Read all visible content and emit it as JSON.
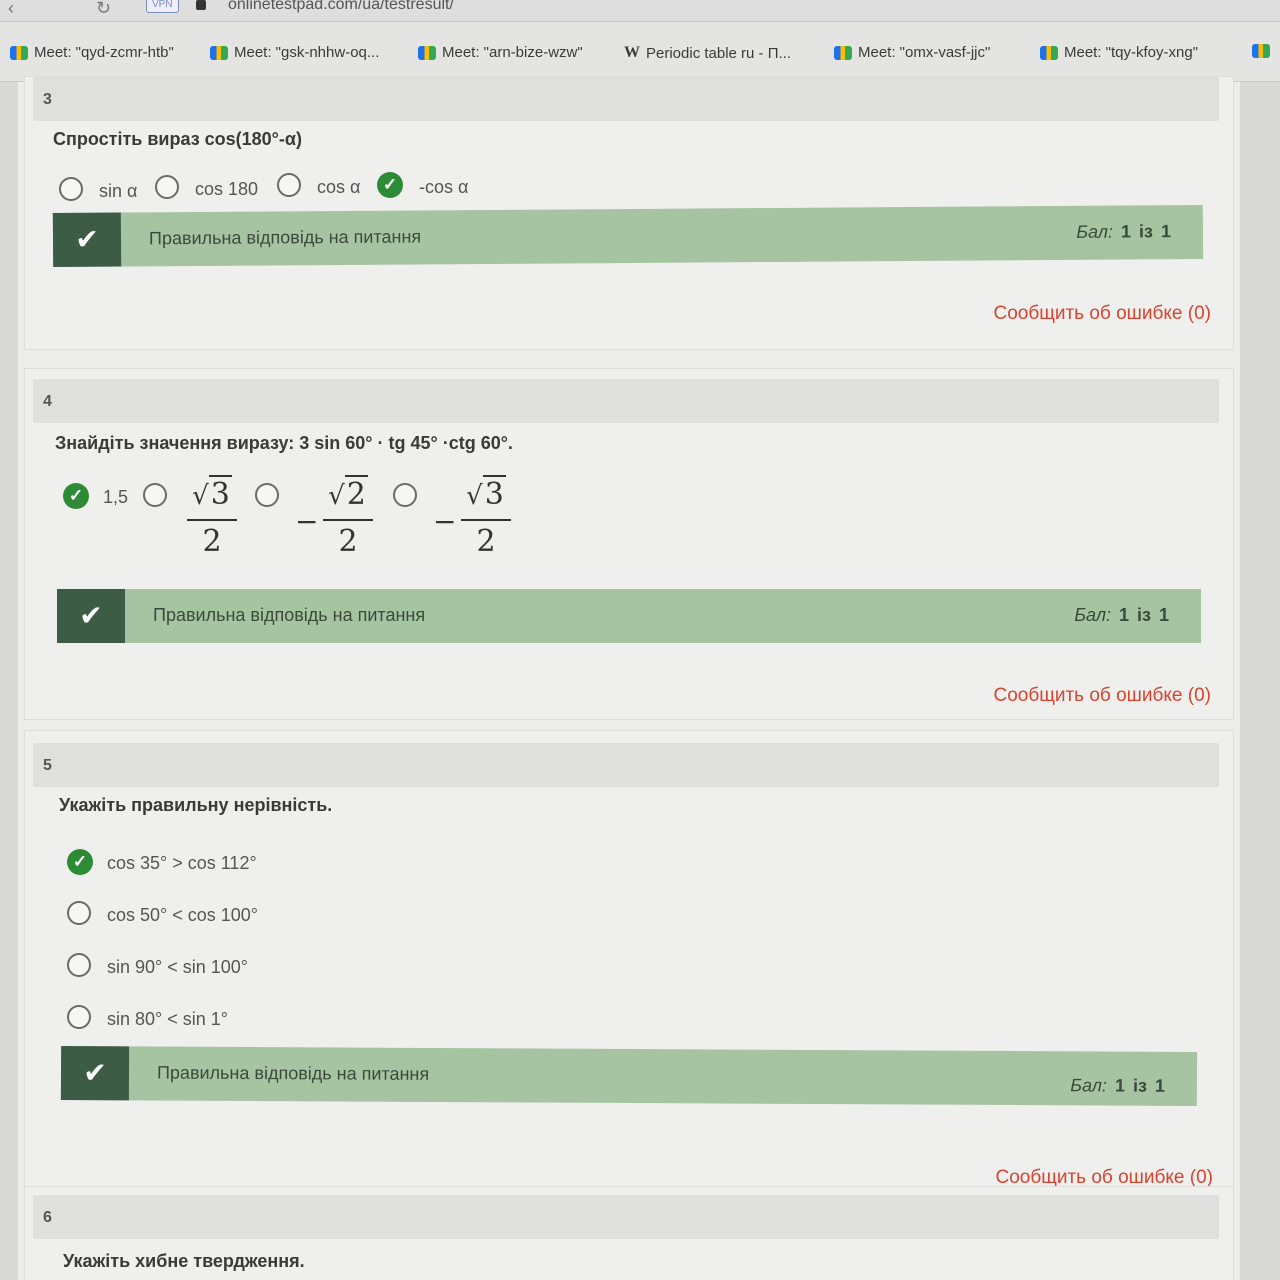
{
  "browser": {
    "vpn_label": "VPN",
    "url": "onlinetestpad.com/ua/testresult/",
    "bookmarks": [
      {
        "label": "Meet: \"qyd-zcmr-htb\"",
        "icon": "meet-icon"
      },
      {
        "label": "Meet: \"gsk-nhhw-oq...",
        "icon": "meet-icon"
      },
      {
        "label": "Meet: \"arn-bize-wzw\"",
        "icon": "meet-icon"
      },
      {
        "label": "Periodic table ru - П...",
        "icon": "wikipedia-icon"
      },
      {
        "label": "Meet: \"omx-vasf-jjc\"",
        "icon": "meet-icon"
      },
      {
        "label": "Meet: \"tqy-kfoy-xng\"",
        "icon": "meet-icon"
      }
    ]
  },
  "colors": {
    "correct": "#2e8b35",
    "result_bar": "#a6c4a2",
    "result_box": "#3d5c45",
    "report": "#d9442f"
  },
  "common": {
    "result_text": "Правильна відповідь на питання",
    "score_label": "Бал:",
    "score_of": "із",
    "report_text": "Сообщить об ошибке (0)"
  },
  "questions": [
    {
      "number": "3",
      "text": "Спростіть вираз cos(180°-α)",
      "options": [
        "sin α",
        "cos 180",
        "cos α",
        "-cos α"
      ],
      "selected": 3,
      "score": "1",
      "max": "1"
    },
    {
      "number": "4",
      "text": "Знайдіть значення виразу:  3 sin 60° · tg 45° ·ctg 60°.",
      "options": [
        "1,5",
        "√3/2",
        "−√2/2",
        "−√3/2"
      ],
      "fractions": [
        {
          "sign": "",
          "radicand": "3",
          "den": "2"
        },
        {
          "sign": "−",
          "radicand": "2",
          "den": "2"
        },
        {
          "sign": "−",
          "radicand": "3",
          "den": "2"
        }
      ],
      "selected": 0,
      "score": "1",
      "max": "1"
    },
    {
      "number": "5",
      "text": "Укажіть правильну нерівність.",
      "options": [
        "cos 35° > cos 112°",
        "cos 50° < cos 100°",
        "sin 90° < sin 100°",
        "sin 80° < sin 1°"
      ],
      "selected": 0,
      "score": "1",
      "max": "1"
    },
    {
      "number": "6",
      "text": "Укажіть хибне твердження."
    }
  ]
}
